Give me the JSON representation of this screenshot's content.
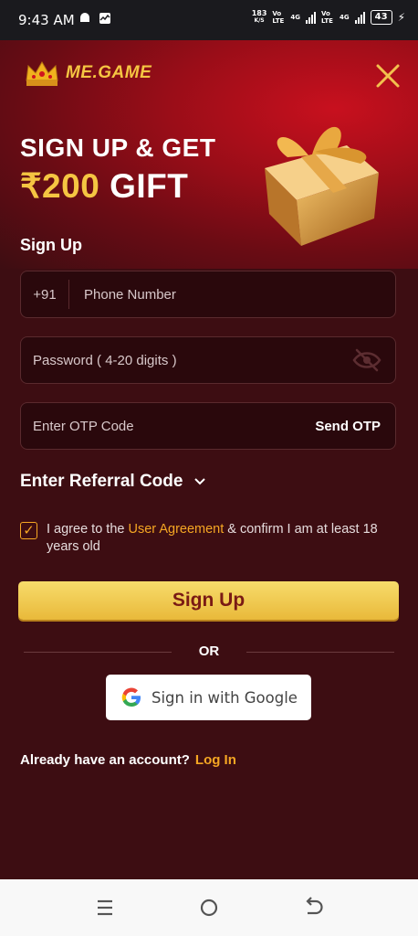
{
  "status_bar": {
    "time": "9:43 AM",
    "speed_top": "183",
    "speed_unit": "K/S",
    "sim1": "Vo LTE",
    "sim1_type": "4G",
    "sim2": "Vo LTE",
    "sim2_type": "4G",
    "battery": "43"
  },
  "brand": {
    "name": "ME.GAME"
  },
  "hero": {
    "line1": "SIGN UP & GET",
    "amount": "₹200",
    "gift_word": "GIFT"
  },
  "form": {
    "title": "Sign Up",
    "country_code": "+91",
    "phone_placeholder": "Phone Number",
    "password_placeholder": "Password ( 4-20 digits )",
    "otp_placeholder": "Enter OTP Code",
    "send_otp": "Send OTP",
    "referral": "Enter Referral Code",
    "agree_prefix": "I agree to the ",
    "agree_link": "User Agreement",
    "agree_suffix": " & confirm I am at least 18 years old",
    "signup_button": "Sign Up",
    "or": "OR",
    "google_button": "Sign in with Google",
    "already": "Already have an account?",
    "login": "Log In"
  },
  "colors": {
    "background": "#3d0d12",
    "accent": "#f5a623",
    "gold": "#f5c542"
  }
}
